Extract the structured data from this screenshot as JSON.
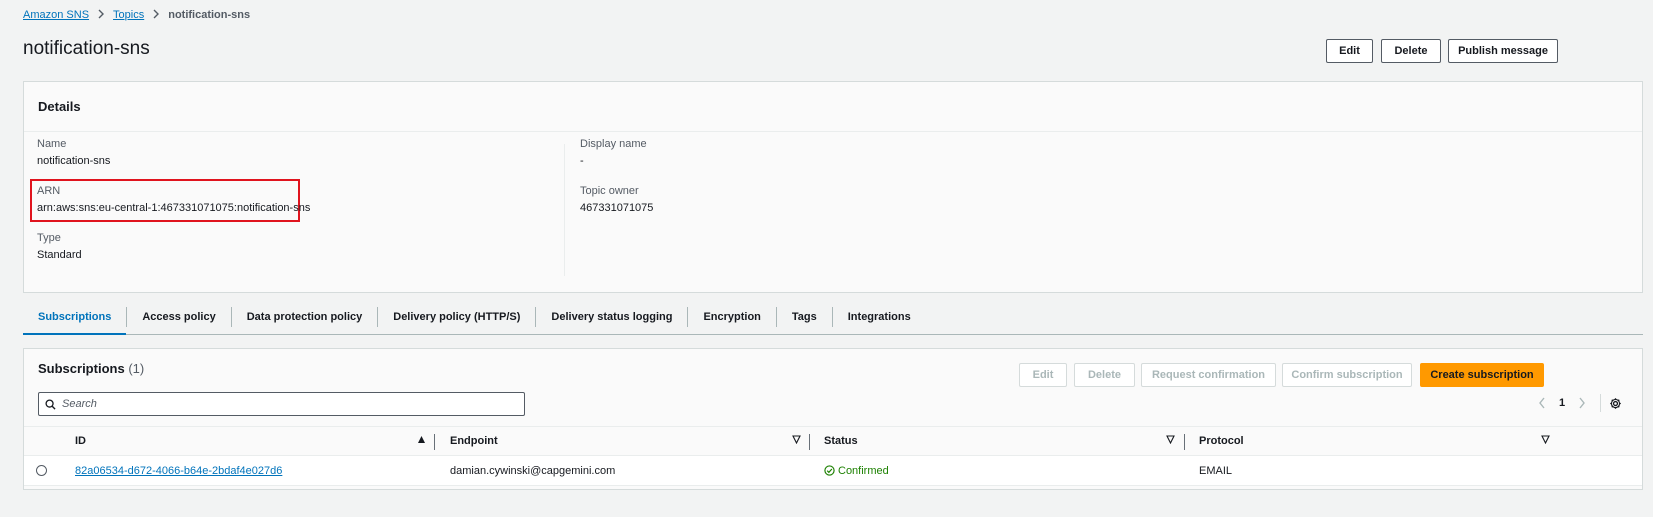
{
  "breadcrumb": {
    "root": "Amazon SNS",
    "topics": "Topics",
    "current": "notification-sns",
    "separator": ">"
  },
  "page": {
    "title": "notification-sns"
  },
  "header_actions": {
    "edit": "Edit",
    "delete": "Delete",
    "publish": "Publish message"
  },
  "details": {
    "heading": "Details",
    "name_label": "Name",
    "name_value": "notification-sns",
    "arn_label": "ARN",
    "arn_value": "arn:aws:sns:eu-central-1:467331071075:notification-sns",
    "type_label": "Type",
    "type_value": "Standard",
    "display_name_label": "Display name",
    "display_name_value": "-",
    "topic_owner_label": "Topic owner",
    "topic_owner_value": "467331071075",
    "highlight_color": "#e0141e"
  },
  "tabs": [
    {
      "label": "Subscriptions",
      "active": true
    },
    {
      "label": "Access policy"
    },
    {
      "label": "Data protection policy"
    },
    {
      "label": "Delivery policy (HTTP/S)"
    },
    {
      "label": "Delivery status logging"
    },
    {
      "label": "Encryption"
    },
    {
      "label": "Tags"
    },
    {
      "label": "Integrations"
    }
  ],
  "subscriptions": {
    "title": "Subscriptions",
    "count": "(1)",
    "actions": {
      "edit": "Edit",
      "delete": "Delete",
      "request_confirmation": "Request confirmation",
      "confirm_subscription": "Confirm subscription",
      "create": "Create subscription"
    },
    "search_placeholder": "Search",
    "page": "1",
    "columns": {
      "id": "ID",
      "endpoint": "Endpoint",
      "status": "Status",
      "protocol": "Protocol"
    },
    "rows": [
      {
        "id": "82a06534-d672-4066-b64e-2bdaf4e027d6",
        "endpoint": "damian.cywinski@capgemini.com",
        "status": "Confirmed",
        "protocol": "EMAIL"
      }
    ]
  },
  "colors": {
    "link": "#0073bb",
    "primary_button": "#ff9900",
    "success": "#1d8102"
  }
}
